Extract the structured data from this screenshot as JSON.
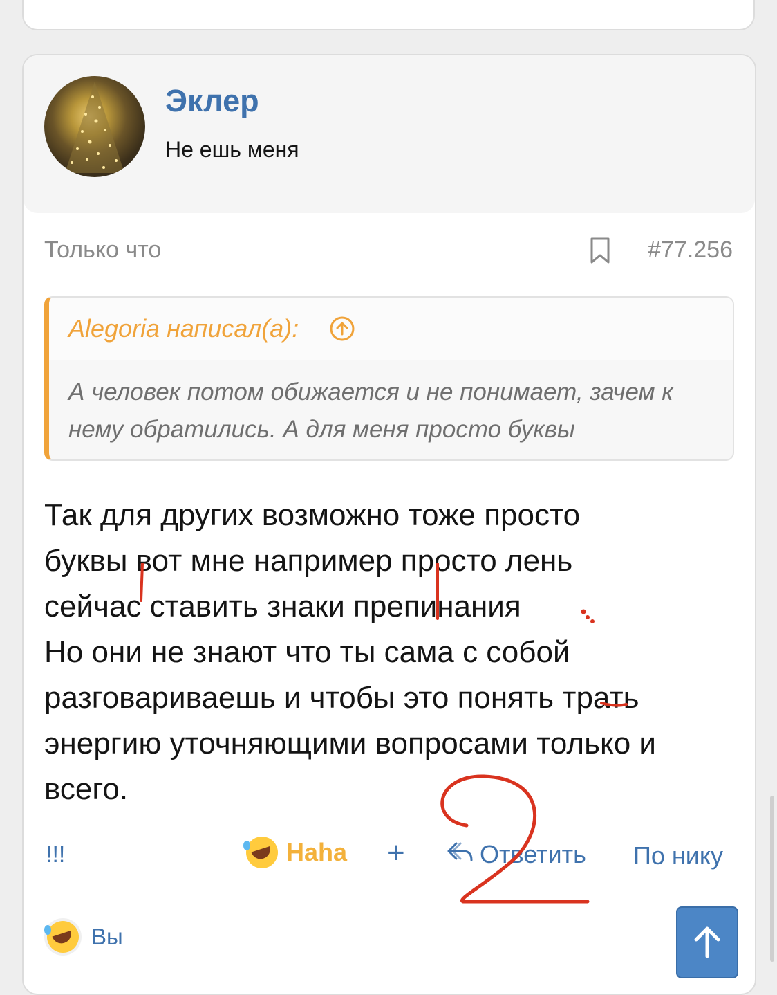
{
  "post": {
    "author_name": "Эклер",
    "author_title": "Не ешь меня",
    "time": "Только что",
    "number": "#77.256",
    "quote": {
      "author": "Alegoria написал(а):",
      "text": "А человек потом обижается и не понимает, зачем к нему обратились. А для меня просто буквы"
    },
    "message_lines": [
      "Так для других возможно тоже просто",
      "буквы вот мне например просто лень",
      "сейчас ставить знаки препинания",
      "Но они не знают что ты сама с собой",
      "разговариваешь и чтобы это понять трать",
      "энергию уточняющими вопросами только и",
      "всего."
    ]
  },
  "actions": {
    "report": "!!!",
    "reaction": "Haha",
    "plus": "+",
    "reply": "Ответить",
    "by_nick": "По нику"
  },
  "reactions_bar": {
    "label": "Вы"
  },
  "colors": {
    "link": "#3f72ad",
    "quote_accent": "#f0a33a",
    "reaction": "#f3b13b",
    "annotation": "#d9331f"
  }
}
